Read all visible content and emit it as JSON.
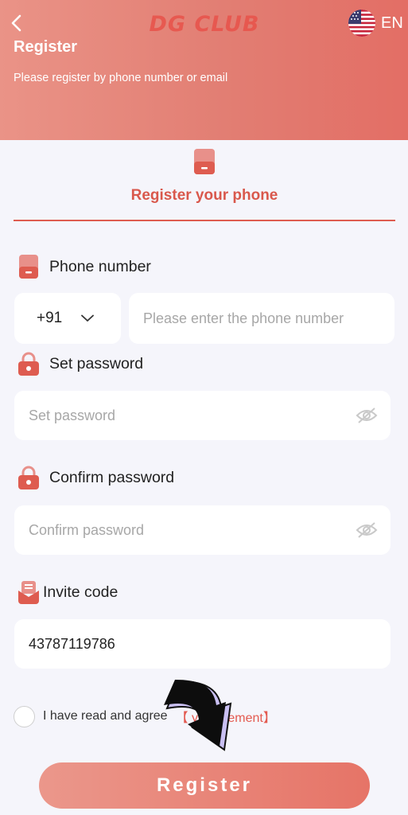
{
  "header": {
    "logo_text": "DG CLUB",
    "language": "EN",
    "title": "Register",
    "subtitle": "Please register by phone number or email"
  },
  "tab": {
    "label": "Register your phone"
  },
  "phone": {
    "label": "Phone number",
    "country_code": "+91",
    "placeholder": "Please enter the phone number"
  },
  "password": {
    "label": "Set password",
    "placeholder": "Set password"
  },
  "confirm": {
    "label": "Confirm password",
    "placeholder": "Confirm password"
  },
  "invite": {
    "label": "Invite code",
    "value": "43787119786"
  },
  "agreement": {
    "text": "I have read and agree",
    "link": "【Privacy Agreement】",
    "link_visible": "【 y Agreement】"
  },
  "submit": {
    "label": "Register"
  },
  "colors": {
    "accent": "#de5c50",
    "header_gradient_start": "#ea9387",
    "header_gradient_end": "#e36e65"
  }
}
